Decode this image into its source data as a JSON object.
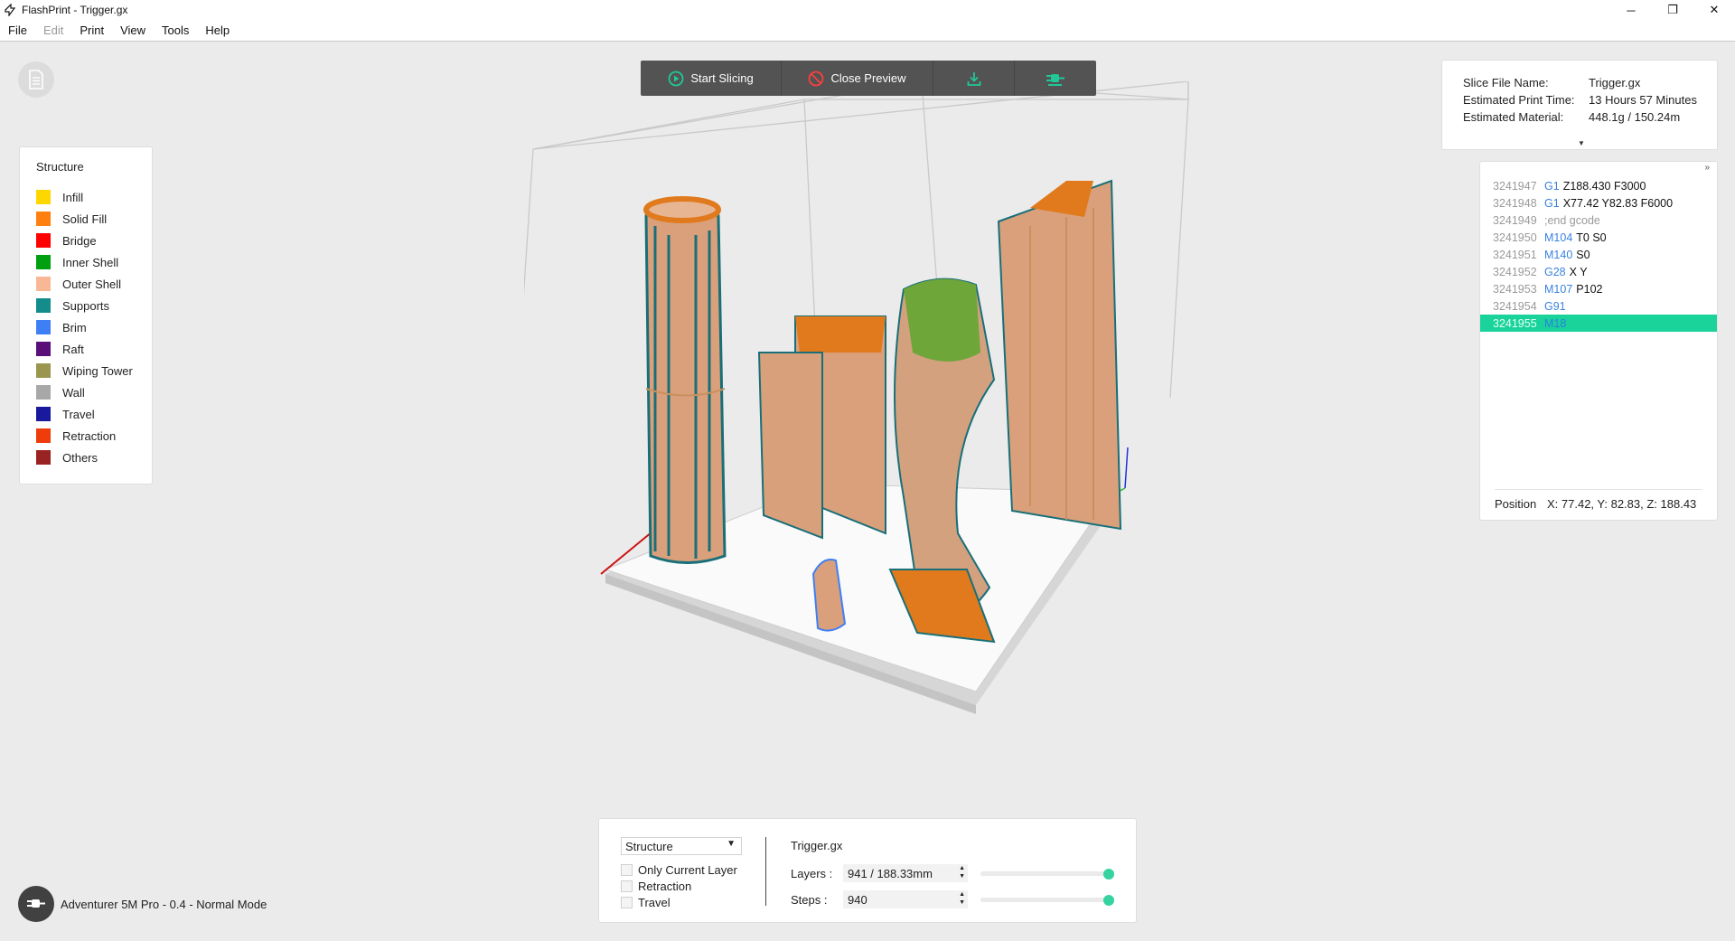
{
  "window": {
    "title": "FlashPrint - Trigger.gx",
    "minimize": "─",
    "maximize": "❐",
    "close": "✕"
  },
  "menu": {
    "items": [
      "File",
      "Edit",
      "Print",
      "View",
      "Tools",
      "Help"
    ]
  },
  "toolbar": {
    "start_slicing": "Start Slicing",
    "close_preview": "Close Preview",
    "accent": "#21c796"
  },
  "legend": {
    "title": "Structure",
    "items": [
      {
        "label": "Infill",
        "color": "#ffd700"
      },
      {
        "label": "Solid Fill",
        "color": "#ff7f0f"
      },
      {
        "label": "Bridge",
        "color": "#ff0000"
      },
      {
        "label": "Inner Shell",
        "color": "#00a010"
      },
      {
        "label": "Outer Shell",
        "color": "#f8b896"
      },
      {
        "label": "Supports",
        "color": "#148c8c"
      },
      {
        "label": "Brim",
        "color": "#3f7ff5"
      },
      {
        "label": "Raft",
        "color": "#5a0f78"
      },
      {
        "label": "Wiping Tower",
        "color": "#9a9650"
      },
      {
        "label": "Wall",
        "color": "#a8a8a8"
      },
      {
        "label": "Travel",
        "color": "#19199e"
      },
      {
        "label": "Retraction",
        "color": "#ee3c0a"
      },
      {
        "label": "Others",
        "color": "#992222"
      }
    ]
  },
  "info": {
    "rows": [
      {
        "key": "Slice File Name:",
        "value": "Trigger.gx"
      },
      {
        "key": "Estimated Print Time:",
        "value": "13 Hours 57 Minutes"
      },
      {
        "key": "Estimated Material:",
        "value": "448.1g / 150.24m"
      }
    ]
  },
  "gcode": {
    "lines": [
      {
        "n": "3241947",
        "cmd": "G1",
        "args": "Z188.430 F3000",
        "comment": ""
      },
      {
        "n": "3241948",
        "cmd": "G1",
        "args": "X77.42 Y82.83 F6000",
        "comment": ""
      },
      {
        "n": "3241949",
        "cmd": "",
        "args": "",
        "comment": ";end gcode"
      },
      {
        "n": "3241950",
        "cmd": "M104",
        "args": "T0 S0",
        "comment": ""
      },
      {
        "n": "3241951",
        "cmd": "M140",
        "args": "S0",
        "comment": ""
      },
      {
        "n": "3241952",
        "cmd": "G28",
        "args": "X Y",
        "comment": ""
      },
      {
        "n": "3241953",
        "cmd": "M107",
        "args": "P102",
        "comment": ""
      },
      {
        "n": "3241954",
        "cmd": "G91",
        "args": "",
        "comment": ""
      },
      {
        "n": "3241955",
        "cmd": "M18",
        "args": "",
        "comment": ""
      }
    ],
    "selected_index": 8,
    "position_label": "Position",
    "position_value": "X: 77.42, Y: 82.83, Z: 188.43"
  },
  "controls": {
    "view_mode": "Structure",
    "options": [
      {
        "label": "Only Current Layer",
        "checked": false
      },
      {
        "label": "Retraction",
        "checked": false
      },
      {
        "label": "Travel",
        "checked": false
      }
    ],
    "file_name": "Trigger.gx",
    "layers_label": "Layers :",
    "layers_value": "941 / 188.33mm",
    "layers_fraction": 1.0,
    "steps_label": "Steps :",
    "steps_value": "940",
    "steps_fraction": 1.0
  },
  "status": {
    "printer": "Adventurer 5M Pro - 0.4 - Normal Mode"
  }
}
